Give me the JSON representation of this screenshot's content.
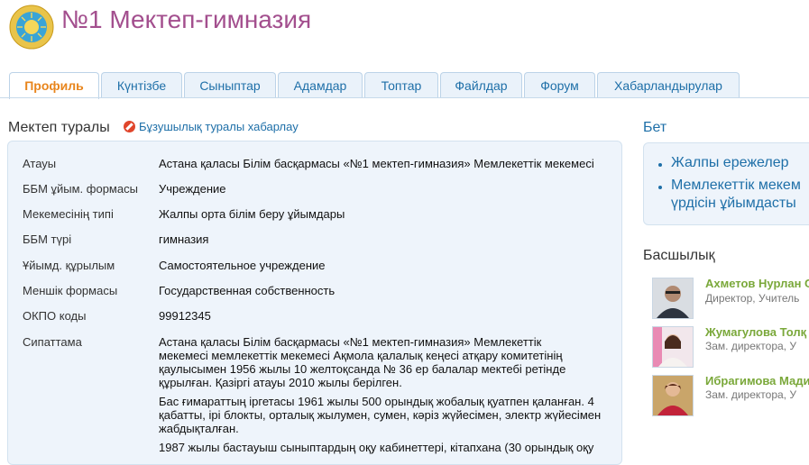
{
  "header": {
    "title": "№1 Мектеп-гимназия"
  },
  "tabs": [
    {
      "label": "Профиль",
      "active": true
    },
    {
      "label": "Күнтізбе",
      "active": false
    },
    {
      "label": "Сыныптар",
      "active": false
    },
    {
      "label": "Адамдар",
      "active": false
    },
    {
      "label": "Топтар",
      "active": false
    },
    {
      "label": "Файлдар",
      "active": false
    },
    {
      "label": "Форум",
      "active": false
    },
    {
      "label": "Хабарландырулар",
      "active": false
    }
  ],
  "about": {
    "title": "Мектеп туралы",
    "report_link": "Бұзушылық туралы хабарлау",
    "rows": [
      {
        "label": "Атауы",
        "value": "Астана қаласы Білім басқармасы «№1 мектеп-гимназия» Мемлекеттік мекемесі"
      },
      {
        "label": "ББМ ұйым. формасы",
        "value": "Учреждение"
      },
      {
        "label": "Мекемесінің типі",
        "value": "Жалпы орта білім беру ұйымдары"
      },
      {
        "label": "ББМ түрі",
        "value": "гимназия"
      },
      {
        "label": "Ұйымд. құрылым",
        "value": "Самостоятельное учреждение"
      },
      {
        "label": "Меншік формасы",
        "value": "Государственная собственность"
      },
      {
        "label": "ОКПО коды",
        "value": "99912345"
      }
    ],
    "description_label": "Сипаттама",
    "description": [
      [
        "Астана қаласы Білім басқармасы «№1 мектеп-гимназия» Мемлекеттік",
        "мекемесі мемлекеттік мекемесі Ақмола қалалық кеңесі атқару комитетінің",
        "қаулысымен 1956 жылы 10 желтоқсанда № 36 ер балалар мектебі ретінде",
        "құрылған. Қазіргі атауы 2010 жылы берілген."
      ],
      [
        "Бас ғимараттың іргетасы 1961 жылы 500 орындық жобалық қуатпен қаланған. 4",
        "қабатты, ірі блокты, орталық жылумен, сумен, кәріз жүйесімен, электр жүйесімен",
        "жабдықталған."
      ],
      [
        "1987 жылы бастауыш сыныптардың оқу кабинеттері, кітапхана (30 орындық оқу"
      ]
    ]
  },
  "page": {
    "title": "Бет",
    "links": [
      "Жалпы ережелер",
      "Мемлекеттік мекем",
      "үрдісін ұйымдасты"
    ]
  },
  "leadership": {
    "title": "Басшылық",
    "people": [
      {
        "name": "Ахметов Нурлан С",
        "role": "Директор, Учитель"
      },
      {
        "name": "Жумагулова Толқ",
        "role": "Зам. директора, У"
      },
      {
        "name": "Ибрагимова Мади",
        "role": "Зам. директора, У"
      }
    ]
  }
}
